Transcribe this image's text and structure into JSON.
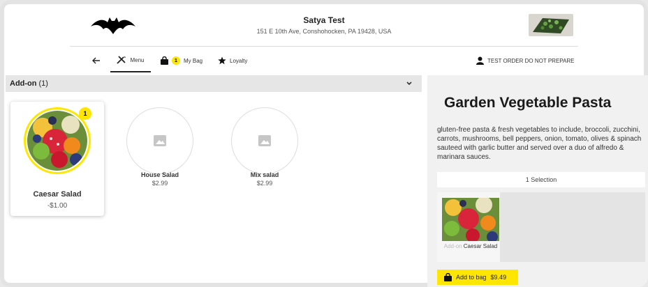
{
  "store": {
    "name": "Satya Test",
    "address": "151 E 10th Ave, Conshohocken, PA 19428, USA"
  },
  "nav": {
    "back_icon": "arrow-left-icon",
    "menu_label": "Menu",
    "bag_label": "My Bag",
    "bag_count": "1",
    "loyalty_label": "Loyalty",
    "order_note": "TEST ORDER DO NOT PREPARE"
  },
  "section": {
    "title": "Add-on",
    "count": "(1)"
  },
  "items": [
    {
      "name": "Caesar Salad",
      "price": "-$1.00",
      "badge": "1",
      "selected": true
    },
    {
      "name": "House Salad",
      "price": "$2.99",
      "selected": false
    },
    {
      "name": "Mix salad",
      "price": "$2.99",
      "selected": false
    }
  ],
  "detail": {
    "title": "Garden Vegetable Pasta",
    "description": "gluten-free pasta & fresh vegetables to include, broccoli, zucchini, carrots, mushrooms, bell peppers, onion, tomato, olives & spinach sauteed with garlic butter and served over a duo of alfredo & marinara sauces.",
    "selection_label": "1 Selection",
    "selected_category": "Add-on",
    "selected_name": "Caesar Salad",
    "add_label": "Add to bag",
    "add_price": "$9.49"
  },
  "colors": {
    "accent": "#ffe600",
    "panel": "#f1f1f1",
    "section_bar": "#e6e6e6"
  }
}
